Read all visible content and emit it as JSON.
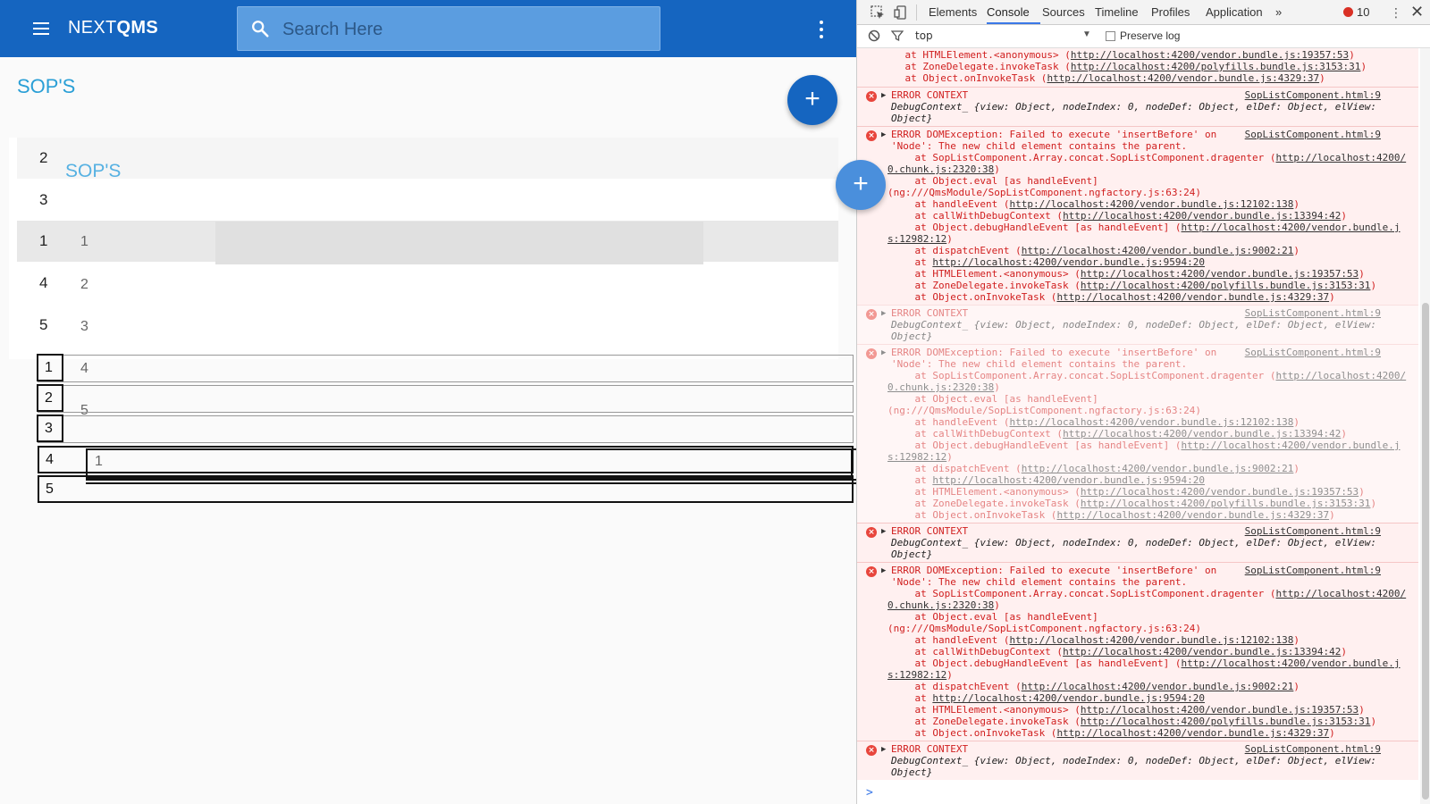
{
  "app": {
    "brand_prefix": "NEXT",
    "brand_suffix": "QMS",
    "search_placeholder": "Search Here",
    "page_title": "SOP'S",
    "ghost_title": "SOP'S",
    "fab_label": "+",
    "list_a": [
      "2",
      "3",
      "1",
      "4",
      "5"
    ],
    "ghost_list": [
      "1",
      "2",
      "3",
      "4",
      "5"
    ],
    "box_list": [
      "1",
      "2",
      "3",
      "4",
      "5"
    ],
    "drag_item": "1",
    "colors": {
      "appbar": "#1565c0",
      "accent": "#2a9fd6"
    }
  },
  "devtools": {
    "tabs": [
      "Elements",
      "Console",
      "Sources",
      "Timeline",
      "Profiles",
      "Application",
      "»"
    ],
    "active_tab": "Console",
    "error_count": "10",
    "filter_context": "top",
    "preserve_log": "Preserve log",
    "prompt": ">",
    "messages": [
      {
        "kind": "stack-tail",
        "lines": [
          "    at HTMLElement.<anonymous> (|http://localhost:4200/vendor.bundle.js:19357:53|)",
          "    at ZoneDelegate.invokeTask (|http://localhost:4200/polyfills.bundle.js:3153:31|)",
          "    at Object.onInvokeTask (|http://localhost:4200/vendor.bundle.js:4329:37|)"
        ]
      },
      {
        "kind": "context",
        "title": "ERROR CONTEXT",
        "source": "SopListComponent.html:9",
        "ctx_line1": "DebugContext_ {view: Object, nodeIndex: 0, nodeDef: Object, elDef: Object, elView:",
        "ctx_line2": "Object}"
      },
      {
        "kind": "error",
        "source": "SopListComponent.html:9",
        "lines": [
          "ERROR DOMException: Failed to execute 'insertBefore' on",
          "'Node': The new child element contains the parent.",
          "    at SopListComponent.Array.concat.SopListComponent.dragenter (|http://localhost:4200/|",
          "|0.chunk.js:2320:38|)",
          "    at Object.eval [as handleEvent]",
          "(ng:///QmsModule/SopListComponent.ngfactory.js:63:24)",
          "    at handleEvent (|http://localhost:4200/vendor.bundle.js:12102:138|)",
          "    at callWithDebugContext (|http://localhost:4200/vendor.bundle.js:13394:42|)",
          "    at Object.debugHandleEvent [as handleEvent] (|http://localhost:4200/vendor.bundle.j|",
          "|s:12982:12|)",
          "    at dispatchEvent (|http://localhost:4200/vendor.bundle.js:9002:21|)",
          "    at |http://localhost:4200/vendor.bundle.js:9594:20|",
          "    at HTMLElement.<anonymous> (|http://localhost:4200/vendor.bundle.js:19357:53|)",
          "    at ZoneDelegate.invokeTask (|http://localhost:4200/polyfills.bundle.js:3153:31|)",
          "    at Object.onInvokeTask (|http://localhost:4200/vendor.bundle.js:4329:37|)"
        ]
      },
      {
        "kind": "context",
        "title": "ERROR CONTEXT",
        "source": "SopListComponent.html:9",
        "ctx_line1": "DebugContext_ {view: Object, nodeIndex: 0, nodeDef: Object, elDef: Object, elView:",
        "ctx_line2": "Object}"
      },
      {
        "kind": "error",
        "source": "SopListComponent.html:9",
        "lines": [
          "ERROR DOMException: Failed to execute 'insertBefore' on",
          "'Node': The new child element contains the parent.",
          "    at SopListComponent.Array.concat.SopListComponent.dragenter (|http://localhost:4200/|",
          "|0.chunk.js:2320:38|)",
          "    at Object.eval [as handleEvent]",
          "(ng:///QmsModule/SopListComponent.ngfactory.js:63:24)",
          "    at handleEvent (|http://localhost:4200/vendor.bundle.js:12102:138|)",
          "    at callWithDebugContext (|http://localhost:4200/vendor.bundle.js:13394:42|)",
          "    at Object.debugHandleEvent [as handleEvent] (|http://localhost:4200/vendor.bundle.j|",
          "|s:12982:12|)",
          "    at dispatchEvent (|http://localhost:4200/vendor.bundle.js:9002:21|)",
          "    at |http://localhost:4200/vendor.bundle.js:9594:20|",
          "    at HTMLElement.<anonymous> (|http://localhost:4200/vendor.bundle.js:19357:53|)",
          "    at ZoneDelegate.invokeTask (|http://localhost:4200/polyfills.bundle.js:3153:31|)",
          "    at Object.onInvokeTask (|http://localhost:4200/vendor.bundle.js:4329:37|)"
        ]
      },
      {
        "kind": "context",
        "title": "ERROR CONTEXT",
        "source": "SopListComponent.html:9",
        "ctx_line1": "DebugContext_ {view: Object, nodeIndex: 0, nodeDef: Object, elDef: Object, elView:",
        "ctx_line2": "Object}"
      },
      {
        "kind": "error",
        "source": "SopListComponent.html:9",
        "lines": [
          "ERROR DOMException: Failed to execute 'insertBefore' on",
          "'Node': The new child element contains the parent.",
          "    at SopListComponent.Array.concat.SopListComponent.dragenter (|http://localhost:4200/|",
          "|0.chunk.js:2320:38|)",
          "    at Object.eval [as handleEvent]",
          "(ng:///QmsModule/SopListComponent.ngfactory.js:63:24)",
          "    at handleEvent (|http://localhost:4200/vendor.bundle.js:12102:138|)",
          "    at callWithDebugContext (|http://localhost:4200/vendor.bundle.js:13394:42|)",
          "    at Object.debugHandleEvent [as handleEvent] (|http://localhost:4200/vendor.bundle.j|",
          "|s:12982:12|)",
          "    at dispatchEvent (|http://localhost:4200/vendor.bundle.js:9002:21|)",
          "    at |http://localhost:4200/vendor.bundle.js:9594:20|",
          "    at HTMLElement.<anonymous> (|http://localhost:4200/vendor.bundle.js:19357:53|)",
          "    at ZoneDelegate.invokeTask (|http://localhost:4200/polyfills.bundle.js:3153:31|)",
          "    at Object.onInvokeTask (|http://localhost:4200/vendor.bundle.js:4329:37|)"
        ]
      },
      {
        "kind": "context",
        "title": "ERROR CONTEXT",
        "source": "SopListComponent.html:9",
        "ctx_line1": "DebugContext_ {view: Object, nodeIndex: 0, nodeDef: Object, elDef: Object, elView:",
        "ctx_line2": "Object}"
      }
    ]
  }
}
